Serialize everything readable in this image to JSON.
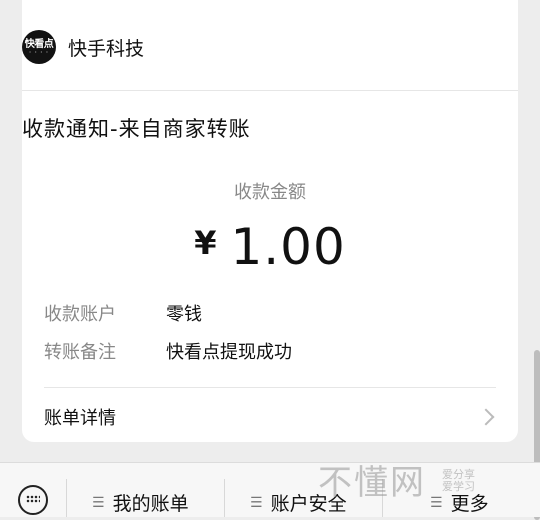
{
  "header": {
    "logo_text": "快看点",
    "merchant": "快手科技"
  },
  "notice": {
    "title": "收款通知-来自商家转账",
    "amount_label": "收款金额",
    "currency": "¥",
    "amount": "1.00",
    "rows": [
      {
        "key": "收款账户",
        "value": "零钱"
      },
      {
        "key": "转账备注",
        "value": "快看点提现成功"
      }
    ],
    "bill_label": "账单详情"
  },
  "bottom_menu": {
    "items": [
      "我的账单",
      "账户安全",
      "更多"
    ]
  },
  "watermark": {
    "main": "不懂网",
    "sub1": "爱分享",
    "sub2": "爱学习"
  }
}
